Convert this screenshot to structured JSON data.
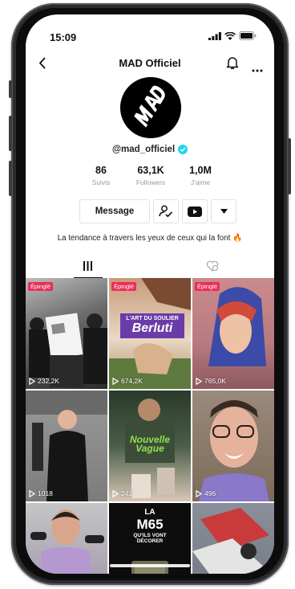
{
  "status_bar": {
    "time": "15:09"
  },
  "header": {
    "title": "MAD Officiel"
  },
  "profile": {
    "avatar_text": "MAD",
    "handle": "@mad_officiel",
    "stats": [
      {
        "value": "86",
        "label": "Suivis"
      },
      {
        "value": "63,1K",
        "label": "Followers"
      },
      {
        "value": "1,0M",
        "label": "J'aime"
      }
    ],
    "message_label": "Message",
    "bio": "La tendance à travers les yeux de ceux qui la font 🔥"
  },
  "tabs": [
    {
      "name": "videos-tab",
      "icon": "grid-icon",
      "selected": true
    },
    {
      "name": "liked-tab",
      "icon": "liked-heart-icon",
      "selected": false
    }
  ],
  "videos": [
    {
      "pinned": true,
      "pin_label": "Épinglé",
      "views": "232,2K"
    },
    {
      "pinned": true,
      "pin_label": "Épinglé",
      "views": "674,2K",
      "overlay": [
        "L'ART DU SOULIER",
        "Berluti"
      ]
    },
    {
      "pinned": true,
      "pin_label": "Épinglé",
      "views": "765,0K"
    },
    {
      "pinned": false,
      "views": "1018"
    },
    {
      "pinned": false,
      "views": "242",
      "overlay": [
        "Nouvelle Vague"
      ]
    },
    {
      "pinned": false,
      "views": "496"
    },
    {
      "pinned": false,
      "views": ""
    },
    {
      "pinned": false,
      "views": "",
      "overlay": [
        "LA",
        "M65",
        "QU'ILS VONT DÉCORER"
      ]
    },
    {
      "pinned": false,
      "views": ""
    }
  ],
  "colors": {
    "pin": "#ea2d5a",
    "verified": "#20d5ec",
    "accent_red": "#fe2c55"
  }
}
